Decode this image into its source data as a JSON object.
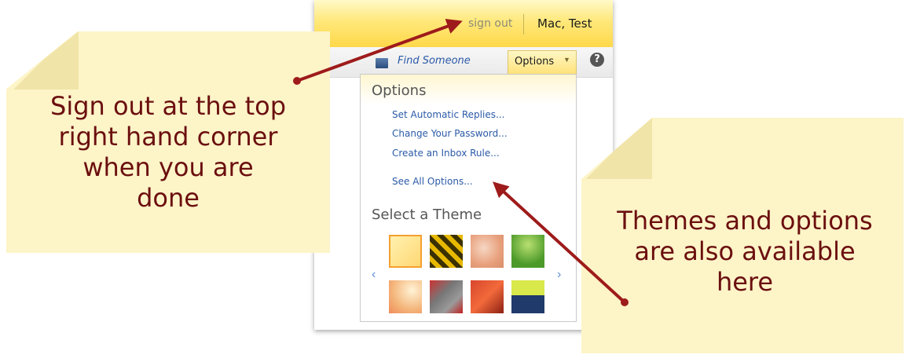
{
  "header": {
    "signout_label": "sign out",
    "user_name": "Mac, Test"
  },
  "toolbar": {
    "find_someone": "Find Someone",
    "options_label": "Options",
    "help_icon": "?"
  },
  "options_menu": {
    "title": "Options",
    "links": [
      "Set Automatic Replies...",
      "Change Your Password...",
      "Create an Inbox Rule...",
      "See All Options..."
    ],
    "theme_title": "Select a Theme",
    "theme_prev": "‹",
    "theme_next": "›"
  },
  "callouts": {
    "left_lines": [
      "Sign out at the top",
      "right hand corner",
      "when you are",
      "done"
    ],
    "right_lines": [
      "Themes and options",
      "are also available",
      "here"
    ]
  },
  "colors": {
    "arrow": "#9e1b1b",
    "callout_text": "#6b0f0f",
    "callout_bg": "#fdf4c8"
  }
}
